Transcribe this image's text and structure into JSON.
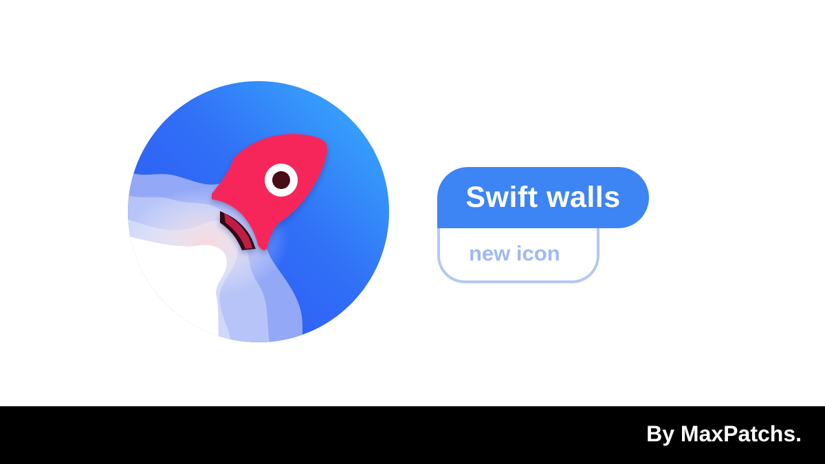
{
  "title": "Swift walls",
  "subtitle": "new icon",
  "credit": "By MaxPatchs.",
  "icon": "rocket-app-icon",
  "colors": {
    "background": "#ffffff",
    "accent_blue": "#3d84f5",
    "light_blue_outline": "#b4c8f5",
    "subtitle_text": "#9fbaf4",
    "rocket_red": "#f7265a",
    "footer": "#000000"
  }
}
